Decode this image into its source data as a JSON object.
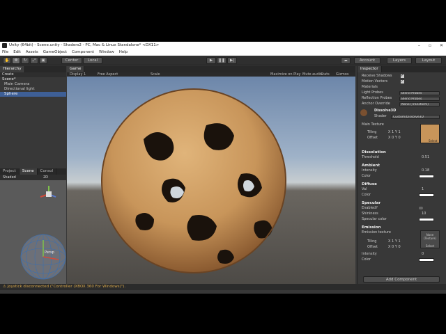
{
  "window": {
    "title": "Unity (64bit) - Scene.unity - Shaders2 - PC, Mac & Linux Standalone* <DX11>"
  },
  "menu": [
    "File",
    "Edit",
    "Assets",
    "GameObject",
    "Component",
    "Window",
    "Help"
  ],
  "toolbar": {
    "center": "Center",
    "local": "Local",
    "account": "Account",
    "layers": "Layers",
    "layout": "Layout"
  },
  "hierarchy": {
    "tab": "Hierarchy",
    "create": "Create",
    "scene": "Scene*",
    "items": [
      "Main Camera",
      "Directional light",
      "Sphere"
    ]
  },
  "bottomleft": {
    "tabs": [
      "Project",
      "Scene",
      "Consol"
    ],
    "shaded": "Shaded",
    "mode": "2D",
    "persp": "Persp"
  },
  "game": {
    "tab": "Game",
    "display": "Display 1",
    "aspect": "Free Aspect",
    "scale": "Scale",
    "maximize": "Maximize on Play",
    "mute": "Mute audio",
    "stats": "Stats",
    "gizmos": "Gizmos"
  },
  "inspector": {
    "tab": "Inspector",
    "receive_shadows": "Receive Shadows",
    "motion_vectors": "Motion Vectors",
    "materials": "Materials",
    "light_probes": "Light Probes",
    "light_probes_val": "Blend Probes",
    "refl_probes": "Reflection Probes",
    "refl_probes_val": "Blend Probes",
    "anchor": "Anchor Override",
    "anchor_val": "None (Transform)",
    "material": "Dissolve3D",
    "shader": "Shader",
    "shader_val": "Custom/Dissolve3D",
    "main_texture": "Main Texture",
    "tiling": "Tiling",
    "offset": "Offset",
    "select": "Select",
    "x": "X",
    "y": "Y",
    "one": "1",
    "zero": "0",
    "dissolution": "Dissolution",
    "threshold": "Threshold",
    "threshold_val": "0.51",
    "ambient": "Ambient",
    "intensity": "Intensity",
    "ambient_int": "0.18",
    "color": "Color",
    "diffuse": "Diffuse",
    "val": "Val",
    "val_v": "1",
    "specular": "Specular",
    "enabled": "Enabled?",
    "shininess": "Shininess",
    "shininess_v": "10",
    "spec_color": "Specular color",
    "emission": "Emission",
    "emission_tex": "Emission texture",
    "none": "None",
    "texture": "(Texture)",
    "emis_int": "0",
    "add_component": "Add Component"
  },
  "status": {
    "message": "Joystick disconnected (\"Controller (XBOX 360 For Windows)\")."
  },
  "colors": {
    "selection": "#3e5f96",
    "wood": "#c8955a"
  }
}
